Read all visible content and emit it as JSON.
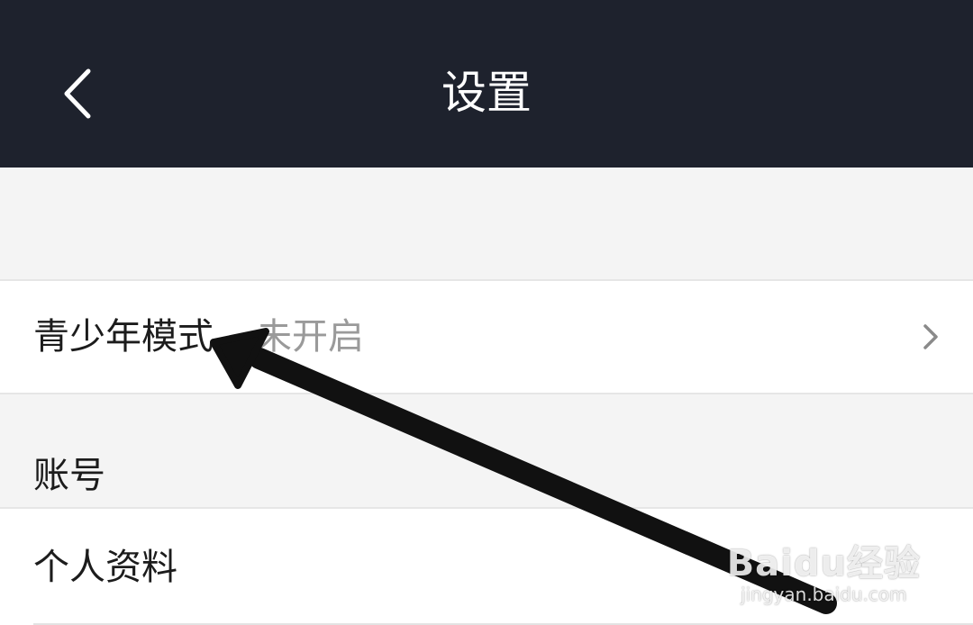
{
  "header": {
    "title": "设置",
    "back_icon": "chevron-left-icon"
  },
  "teen_mode": {
    "label": "青少年模式",
    "value": "未开启",
    "chevron_icon": "chevron-right-icon"
  },
  "account_section": {
    "title": "账号",
    "items": [
      {
        "label": "个人资料"
      }
    ]
  },
  "watermark": {
    "brand": "Baidu经验",
    "url": "jingyan.baidu.com"
  },
  "colors": {
    "header_bg": "#1e222d",
    "page_bg": "#f4f4f4",
    "row_bg": "#ffffff",
    "value_text": "#9a9a9a"
  }
}
